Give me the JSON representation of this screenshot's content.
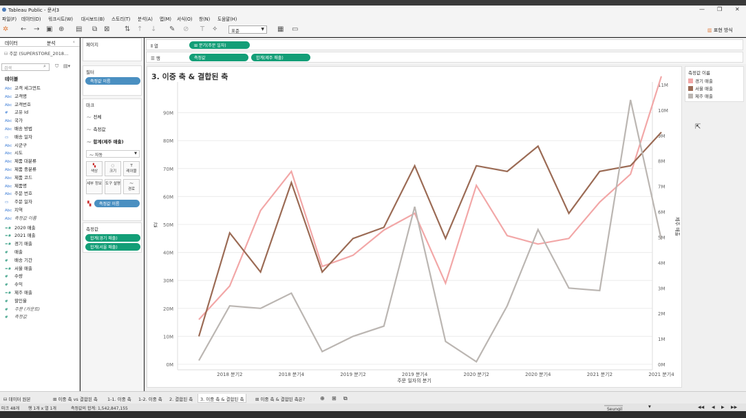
{
  "window": {
    "title": "Tableau Public - 문서3",
    "minimize": "—",
    "maximize": "❐",
    "close": "✕"
  },
  "menu": [
    "파일(F)",
    "데이터(D)",
    "워크시트(W)",
    "대시보드(B)",
    "스토리(T)",
    "분석(A)",
    "맵(M)",
    "서식(O)",
    "창(N)",
    "도움말(H)"
  ],
  "toolbar": {
    "fit": "표준",
    "show_me": "표현 방식"
  },
  "data_pane": {
    "tab_data": "데이터",
    "tab_analysis": "분석",
    "datasource": "주문 (SUPERSTORE_2018...",
    "search_placeholder": "검색",
    "tables_heading": "테이블",
    "fields": [
      {
        "type": "Abc",
        "name": "고객 세그먼트"
      },
      {
        "type": "Abc",
        "name": "고객명"
      },
      {
        "type": "Abc",
        "name": "고객번호"
      },
      {
        "type": "#",
        "name": "고유 Id"
      },
      {
        "type": "Abc",
        "name": "국가"
      },
      {
        "type": "Abc",
        "name": "배송 방법"
      },
      {
        "type": "▭",
        "name": "배송 일자"
      },
      {
        "type": "Abc",
        "name": "시군구"
      },
      {
        "type": "Abc",
        "name": "시도"
      },
      {
        "type": "Abc",
        "name": "제품 대분류"
      },
      {
        "type": "Abc",
        "name": "제품 중분류"
      },
      {
        "type": "Abc",
        "name": "제품 코드"
      },
      {
        "type": "Abc",
        "name": "제품명"
      },
      {
        "type": "Abc",
        "name": "주문 번호"
      },
      {
        "type": "▭",
        "name": "주문 일자"
      },
      {
        "type": "Abc",
        "name": "지역"
      },
      {
        "type": "Abc",
        "name": "측정값 이름",
        "italic": true
      }
    ],
    "measures": [
      {
        "type": "=#",
        "name": "2020 매출"
      },
      {
        "type": "=#",
        "name": "2021 매출"
      },
      {
        "type": "=#",
        "name": "경기 매출"
      },
      {
        "type": "#",
        "name": "매출"
      },
      {
        "type": "#",
        "name": "배송 기간"
      },
      {
        "type": "=#",
        "name": "서울 매출"
      },
      {
        "type": "#",
        "name": "수량"
      },
      {
        "type": "#",
        "name": "수익"
      },
      {
        "type": "=#",
        "name": "제주 매출"
      },
      {
        "type": "#",
        "name": "할인율"
      },
      {
        "type": "#",
        "name": "주문 (카운트)",
        "italic": true
      },
      {
        "type": "#",
        "name": "측정값",
        "italic": true
      }
    ]
  },
  "shelves": {
    "pages": "페이지",
    "filters": "필터",
    "filter_pill": "측정값 이름",
    "marks": "마크",
    "marks_all": "전체",
    "marks_measure": "측정값",
    "marks_sum": "합계(제주 매출)",
    "mark_type": "자동",
    "mark_buttons": [
      "색상",
      "크기",
      "레이블",
      "세부 정보",
      "도구 설명",
      "경로"
    ],
    "color_pill": "측정값 이름",
    "measure_values": "측정값",
    "mv_pills": [
      "합계(경기 매출)",
      "합계(서울 매출)"
    ],
    "columns_label": "열",
    "columns_pill": "분기(주문 일자)",
    "rows_label": "행",
    "rows_pills": [
      "측정값",
      "합계(제주 매출)"
    ]
  },
  "view": {
    "title": "3. 이중 축 & 결합된 축"
  },
  "legend": {
    "title": "측정값 이름",
    "items": [
      {
        "name": "경기 매출",
        "color": "#f2a7a7"
      },
      {
        "name": "서울 매출",
        "color": "#9b6b55"
      },
      {
        "name": "제주 매출",
        "color": "#bbb6b2"
      }
    ]
  },
  "chart_data": {
    "type": "line",
    "title": "3. 이중 축 & 결합된 축",
    "xlabel": "주문 일자의 분기",
    "ylabel_left": "값",
    "ylabel_right": "제주 매출",
    "x": [
      "2018 분기1",
      "2018 분기2",
      "2018 분기3",
      "2018 분기4",
      "2019 분기1",
      "2019 분기2",
      "2019 분기3",
      "2019 분기4",
      "2020 분기1",
      "2020 분기2",
      "2020 분기3",
      "2020 분기4",
      "2021 분기1",
      "2021 분기2",
      "2021 분기3",
      "2021 분기4"
    ],
    "x_tick_labels": [
      "2018 분기2",
      "2018 분기4",
      "2019 분기2",
      "2019 분기4",
      "2020 분기2",
      "2020 분기4",
      "2021 분기2",
      "2021 분기4"
    ],
    "y_left_ticks": [
      "0M",
      "10M",
      "20M",
      "30M",
      "40M",
      "50M",
      "60M",
      "70M",
      "80M",
      "90M"
    ],
    "y_right_ticks": [
      "0M",
      "1M",
      "2M",
      "3M",
      "4M",
      "5M",
      "6M",
      "7M",
      "8M",
      "9M",
      "10M",
      "11M"
    ],
    "ylim_left": [
      0,
      100
    ],
    "ylim_right": [
      0,
      11
    ],
    "grid": "horizontal",
    "series": [
      {
        "name": "경기 매출",
        "axis": "left",
        "color": "#f2a7a7",
        "values": [
          16,
          28,
          55,
          69,
          35,
          39,
          48,
          54,
          29,
          64,
          46,
          43,
          45,
          58,
          68,
          103
        ]
      },
      {
        "name": "서울 매출",
        "axis": "left",
        "color": "#9b6b55",
        "values": [
          10,
          47,
          33,
          65,
          33,
          45,
          49,
          71,
          45,
          71,
          69,
          78,
          54,
          69,
          71,
          83
        ]
      },
      {
        "name": "제주 매출",
        "axis": "right",
        "color": "#bbb6b2",
        "values": [
          0.15,
          2.3,
          2.2,
          2.8,
          0.5,
          1.1,
          1.5,
          6.2,
          0.9,
          0.1,
          2.3,
          5.3,
          3.0,
          2.9,
          10.4,
          4.9
        ]
      }
    ]
  },
  "sheet_tabs": [
    "데이터 원본",
    "이중 축 vs 결합된 축",
    "1-1. 이중 축",
    "1-2. 이중 축",
    "2. 결합된 축",
    "3. 이중 축 & 결합된 축",
    "이중 축 & 결합된 축은?"
  ],
  "status": {
    "marks": "마크 48개",
    "rows_cols": "행 1개 x 열 1개",
    "sum": "측정값의 합계: 1,542,847,155",
    "user": "Seungil Kang"
  }
}
